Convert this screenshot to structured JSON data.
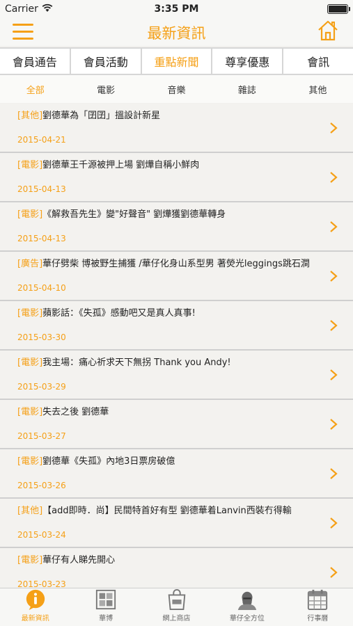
{
  "status_bar": {
    "carrier": "Carrier",
    "time": "3:35 PM"
  },
  "nav": {
    "title": "最新資訊"
  },
  "tabs": [
    {
      "label": "會員通告",
      "active": false
    },
    {
      "label": "會員活動",
      "active": false
    },
    {
      "label": "重點新聞",
      "active": true
    },
    {
      "label": "尊享優惠",
      "active": false
    },
    {
      "label": "會訊",
      "active": false
    }
  ],
  "subtabs": [
    {
      "label": "全部",
      "active": true
    },
    {
      "label": "電影",
      "active": false
    },
    {
      "label": "音樂",
      "active": false
    },
    {
      "label": "雜誌",
      "active": false
    },
    {
      "label": "其他",
      "active": false
    }
  ],
  "news": [
    {
      "tag": "[其他]",
      "title": "劉德華為「囝囝」搵設計新星",
      "date": "2015-04-21"
    },
    {
      "tag": "[電影]",
      "title": "劉德華王千源被押上場 劉燁自稱小鮮肉",
      "date": "2015-04-13"
    },
    {
      "tag": "[電影]",
      "title": "《解救吾先生》變\"好聲音\" 劉燁獲劉德華轉身",
      "date": "2015-04-13"
    },
    {
      "tag": "[廣告]",
      "title": "華仔劈柴 博被野生捕獲 /華仔化身山系型男 著熒光leggings跳石澗",
      "date": "2015-04-10"
    },
    {
      "tag": "[電影]",
      "title": "蘋影話：《失孤》感動吧又是真人真事!",
      "date": "2015-03-30"
    },
    {
      "tag": "[電影]",
      "title": "我主場：痛心祈求天下無拐 Thank you Andy!",
      "date": "2015-03-29"
    },
    {
      "tag": "[電影]",
      "title": "失去之後 劉德華",
      "date": "2015-03-27"
    },
    {
      "tag": "[電影]",
      "title": "劉德華《失孤》內地3日票房破億",
      "date": "2015-03-26"
    },
    {
      "tag": "[其他]",
      "title": "【add即時．尚】民間特首好有型 劉德華着Lanvin西裝冇得輸",
      "date": "2015-03-24"
    },
    {
      "tag": "[電影]",
      "title": "華仔有人睇先開心",
      "date": "2015-03-23"
    }
  ],
  "tab_bar": [
    {
      "label": "最新資訊",
      "icon": "info-icon",
      "active": true
    },
    {
      "label": "華博",
      "icon": "stamp-icon",
      "active": false
    },
    {
      "label": "網上商店",
      "icon": "shopping-bag-icon",
      "active": false
    },
    {
      "label": "華仔全方位",
      "icon": "portrait-icon",
      "active": false
    },
    {
      "label": "行事曆",
      "icon": "calendar-icon",
      "active": false
    }
  ],
  "colors": {
    "accent": "#f5a017",
    "background": "#f3f2ef",
    "divider": "#cfcfcf"
  }
}
